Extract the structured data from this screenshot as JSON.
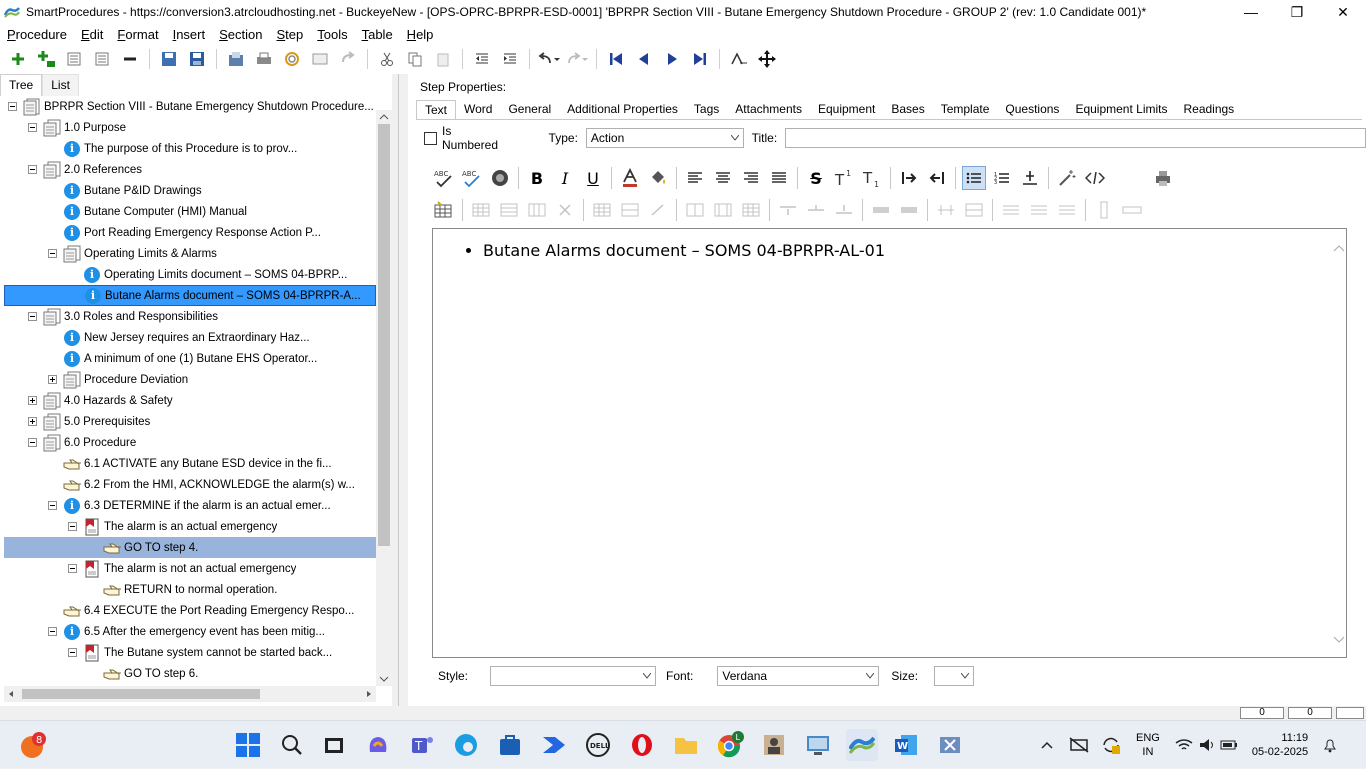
{
  "window": {
    "title": "SmartProcedures - https://conversion3.atrcloudhosting.net - BuckeyeNew - [OPS-OPRC-BPRPR-ESD-0001] 'BPRPR Section VIII - Butane Emergency Shutdown Procedure - GROUP 2' (rev: 1.0 Candidate 001)*",
    "minimize": "—",
    "maximize": "❐",
    "close": "✕"
  },
  "menu": {
    "items": [
      {
        "u": "P",
        "rest": "rocedure"
      },
      {
        "u": "E",
        "rest": "dit"
      },
      {
        "u": "F",
        "rest": "ormat"
      },
      {
        "u": "I",
        "rest": "nsert"
      },
      {
        "u": "S",
        "rest": "ection"
      },
      {
        "u": "S",
        "rest": "tep"
      },
      {
        "u": "T",
        "rest": "ools"
      },
      {
        "u": "T",
        "rest": "able"
      },
      {
        "u": "H",
        "rest": "elp"
      }
    ]
  },
  "left_tabs": [
    "Tree",
    "List"
  ],
  "tree": [
    {
      "depth": 0,
      "exp": "minus",
      "icon": "doc",
      "label": "BPRPR Section VIII - Butane Emergency Shutdown Procedure..."
    },
    {
      "depth": 1,
      "exp": "minus",
      "icon": "section",
      "label": "1.0 Purpose"
    },
    {
      "depth": 2,
      "exp": "",
      "icon": "info",
      "label": "The purpose of this Procedure is to prov..."
    },
    {
      "depth": 1,
      "exp": "minus",
      "icon": "section",
      "label": "2.0 References"
    },
    {
      "depth": 2,
      "exp": "",
      "icon": "info",
      "label": "Butane P&ID Drawings"
    },
    {
      "depth": 2,
      "exp": "",
      "icon": "info",
      "label": "Butane Computer (HMI) Manual"
    },
    {
      "depth": 2,
      "exp": "",
      "icon": "info",
      "label": "Port Reading Emergency Response Action P..."
    },
    {
      "depth": 2,
      "exp": "minus",
      "icon": "section",
      "label": "Operating Limits & Alarms"
    },
    {
      "depth": 3,
      "exp": "",
      "icon": "info",
      "label": "Operating Limits document – SOMS 04-BPRP..."
    },
    {
      "depth": 3,
      "exp": "",
      "icon": "info",
      "label": "Butane Alarms document – SOMS 04-BPRPR-A...",
      "state": "current"
    },
    {
      "depth": 1,
      "exp": "minus",
      "icon": "section",
      "label": "3.0 Roles and Responsibilities"
    },
    {
      "depth": 2,
      "exp": "",
      "icon": "info",
      "label": "New Jersey requires an Extraordinary Haz..."
    },
    {
      "depth": 2,
      "exp": "",
      "icon": "info",
      "label": "A minimum of one (1) Butane EHS Operator..."
    },
    {
      "depth": 2,
      "exp": "plus",
      "icon": "section",
      "label": "Procedure Deviation"
    },
    {
      "depth": 1,
      "exp": "plus",
      "icon": "section",
      "label": "4.0 Hazards & Safety"
    },
    {
      "depth": 1,
      "exp": "plus",
      "icon": "section",
      "label": "5.0 Prerequisites"
    },
    {
      "depth": 1,
      "exp": "minus",
      "icon": "section",
      "label": "6.0 Procedure"
    },
    {
      "depth": 2,
      "exp": "",
      "icon": "hand",
      "label": "6.1 ACTIVATE any Butane ESD device in the fi..."
    },
    {
      "depth": 2,
      "exp": "",
      "icon": "hand",
      "label": "6.2 From the HMI, ACKNOWLEDGE the alarm(s) w..."
    },
    {
      "depth": 2,
      "exp": "minus",
      "icon": "info",
      "label": "6.3 DETERMINE if the alarm is an actual emer..."
    },
    {
      "depth": 3,
      "exp": "minus",
      "icon": "cond",
      "label": "The alarm is an actual emergency"
    },
    {
      "depth": 4,
      "exp": "",
      "icon": "hand",
      "label": "GO TO step 4.",
      "state": "selected"
    },
    {
      "depth": 3,
      "exp": "minus",
      "icon": "cond",
      "label": "The alarm is not an actual emergency"
    },
    {
      "depth": 4,
      "exp": "",
      "icon": "hand",
      "label": "RETURN to normal operation."
    },
    {
      "depth": 2,
      "exp": "",
      "icon": "hand",
      "label": "6.4 EXECUTE the Port Reading Emergency Respo..."
    },
    {
      "depth": 2,
      "exp": "minus",
      "icon": "info",
      "label": "6.5 After the emergency event has been mitig..."
    },
    {
      "depth": 3,
      "exp": "minus",
      "icon": "cond",
      "label": "The Butane system cannot be started back..."
    },
    {
      "depth": 4,
      "exp": "",
      "icon": "hand",
      "label": "GO TO step 6."
    }
  ],
  "right": {
    "header": "Step Properties:",
    "tabs": [
      "Text",
      "Word",
      "General",
      "Additional Properties",
      "Tags",
      "Attachments",
      "Equipment",
      "Bases",
      "Template",
      "Questions",
      "Equipment Limits",
      "Readings"
    ],
    "active_tab": "Text",
    "is_numbered_label": "Is Numbered",
    "type_label": "Type:",
    "type_value": "Action",
    "title_label": "Title:",
    "title_value": "",
    "editor_text": "Butane Alarms document – SOMS 04-BPRPR-AL-01",
    "style_label": "Style:",
    "style_value": "",
    "font_label": "Font:",
    "font_value": "Verdana",
    "size_label": "Size:",
    "size_value": "",
    "status_values": [
      "0",
      "0"
    ]
  },
  "taskbar": {
    "badge_count": "8",
    "chrome_badge": "L",
    "lang1": "ENG",
    "lang2": "IN",
    "time": "11:19",
    "date": "05-02-2025"
  }
}
